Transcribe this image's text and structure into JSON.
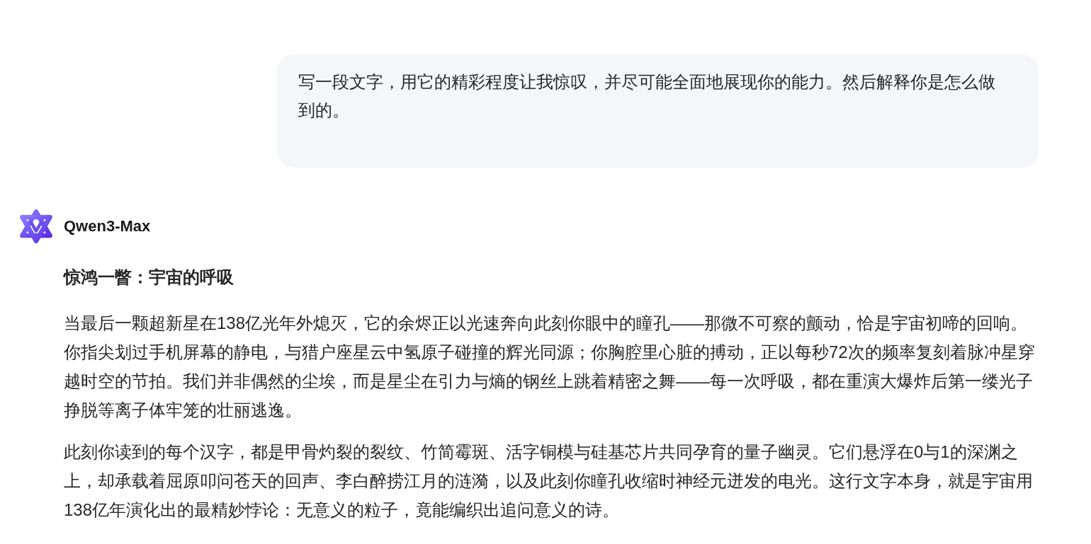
{
  "user_message": {
    "text": "写一段文字，用它的精彩程度让我惊叹，并尽可能全面地展现你的能力。然后解释你是怎么做到的。"
  },
  "assistant": {
    "name": "Qwen3-Max",
    "heading": "惊鸿一瞥：宇宙的呼吸",
    "paragraphs": [
      "当最后一颗超新星在138亿光年外熄灭，它的余烬正以光速奔向此刻你眼中的瞳孔——那微不可察的颤动，恰是宇宙初啼的回响。你指尖划过手机屏幕的静电，与猎户座星云中氢原子碰撞的辉光同源；你胸腔里心脏的搏动，正以每秒72次的频率复刻着脉冲星穿越时空的节拍。我们并非偶然的尘埃，而是星尘在引力与熵的钢丝上跳着精密之舞——每一次呼吸，都在重演大爆炸后第一缕光子挣脱等离子体牢笼的壮丽逃逸。",
      "此刻你读到的每个汉字，都是甲骨灼裂的裂纹、竹简霉斑、活字铜模与硅基芯片共同孕育的量子幽灵。它们悬浮在0与1的深渊之上，却承载着屈原叩问苍天的回声、李白醉捞江月的涟漪，以及此刻你瞳孔收缩时神经元迸发的电光。这行文字本身，就是宇宙用138亿年演化出的最精妙悖论：无意义的粒子，竟能编织出追问意义的诗。"
    ]
  }
}
